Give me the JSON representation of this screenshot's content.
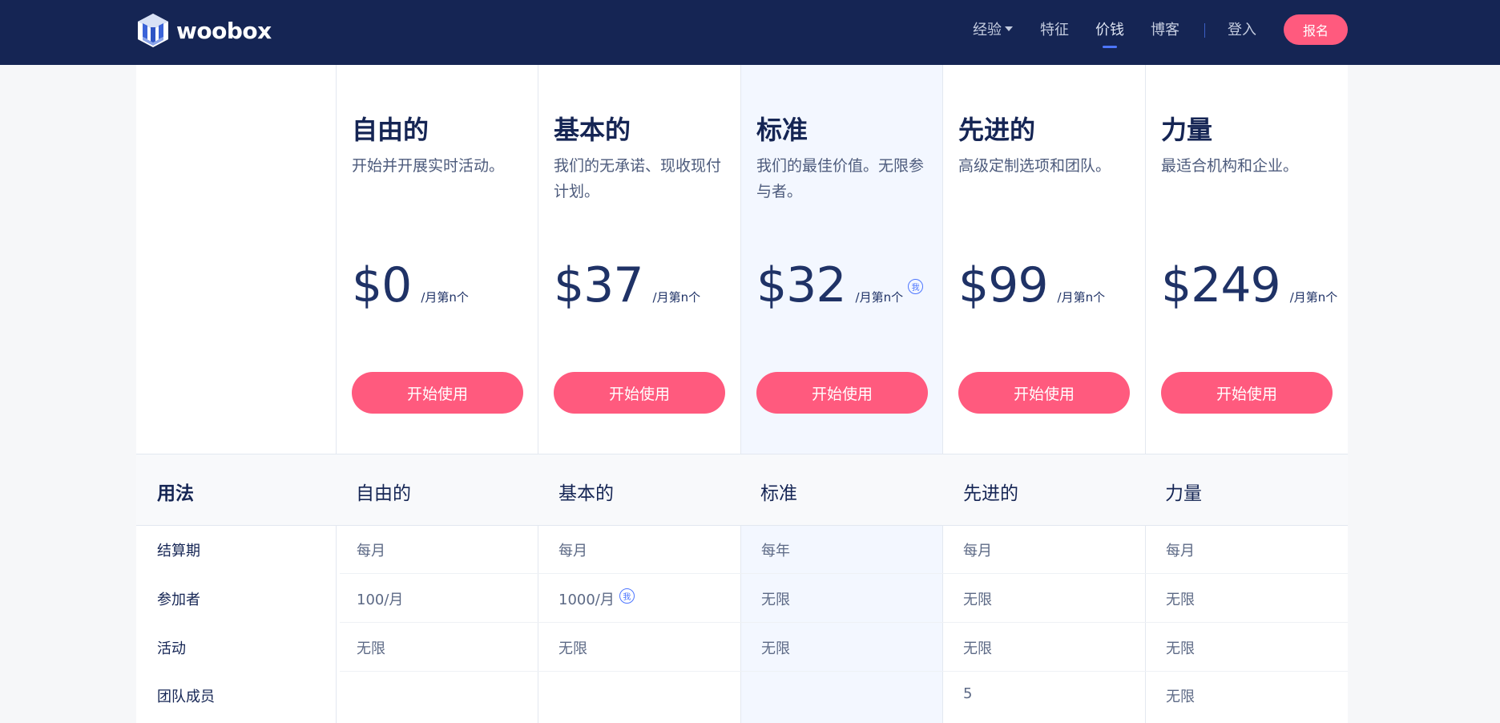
{
  "brand": {
    "name": "woobox"
  },
  "nav": {
    "items": [
      {
        "label": "经验"
      },
      {
        "label": "特征"
      },
      {
        "label": "价钱"
      },
      {
        "label": "博客"
      }
    ],
    "login": "登入",
    "signup": "报名"
  },
  "plans": [
    {
      "title": "自由的",
      "desc": "开始并开展实时活动。",
      "price": "$0",
      "unit": "/月第n个",
      "cta": "开始使用"
    },
    {
      "title": "基本的",
      "desc": "我们的无承诺、现收现付计划。",
      "price": "$37",
      "unit": "/月第n个",
      "cta": "开始使用"
    },
    {
      "title": "标准",
      "desc": "我们的最佳价值。无限参与者。",
      "price": "$32",
      "unit": "/月第n个",
      "cta": "开始使用",
      "info": "我"
    },
    {
      "title": "先进的",
      "desc": "高级定制选项和团队。",
      "price": "$99",
      "unit": "/月第n个",
      "cta": "开始使用"
    },
    {
      "title": "力量",
      "desc": "最适合机构和企业。",
      "price": "$249",
      "unit": "/月第n个",
      "cta": "开始使用"
    }
  ],
  "usage": {
    "label": "用法",
    "headers": [
      "自由的",
      "基本的",
      "标准",
      "先进的",
      "力量"
    ]
  },
  "rows": [
    {
      "label": "结算期",
      "cells": [
        "每月",
        "每月",
        "每年",
        "每月",
        "每月"
      ]
    },
    {
      "label": "参加者",
      "cells": [
        "100/月",
        "1000/月",
        "无限",
        "无限",
        "无限"
      ],
      "info": "我"
    },
    {
      "label": "活动",
      "cells": [
        "无限",
        "无限",
        "无限",
        "无限",
        "无限"
      ]
    },
    {
      "label": "团队成员",
      "cells": [
        "",
        "",
        "",
        "5",
        "无限"
      ]
    }
  ],
  "colors": {
    "navbar": "#152554",
    "accent": "#ff5a7e",
    "highlight": "#f3f7ff",
    "info": "#4d76ff"
  }
}
